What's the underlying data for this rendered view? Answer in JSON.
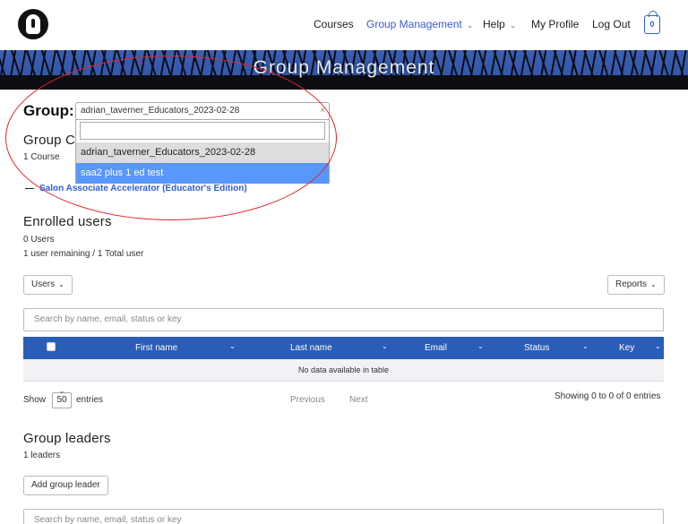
{
  "nav": {
    "items": [
      {
        "label": "Courses",
        "chevron": false
      },
      {
        "label": "Group Management",
        "chevron": true,
        "active": true
      },
      {
        "label": "Help",
        "chevron": true
      },
      {
        "label": "My Profile",
        "chevron": false
      },
      {
        "label": "Log Out",
        "chevron": false
      }
    ],
    "cart_count": "0",
    "accent": "#3a5bd0"
  },
  "banner": {
    "title": "Group Management"
  },
  "group": {
    "label": "Group:",
    "selected": "adrian_taverner_Educators_2023-02-28",
    "clear": "×",
    "options": [
      "adrian_taverner_Educators_2023-02-28",
      "saa2 plus 1 ed test"
    ]
  },
  "courses": {
    "title": "Group C",
    "count": "1 Course",
    "items": [
      "Salon Associate Accelerator (Educator's Edition)"
    ]
  },
  "enrolled": {
    "title": "Enrolled users",
    "count": "0 Users",
    "remaining": "1 user remaining / 1 Total user",
    "users_button": "Users",
    "reports_button": "Reports",
    "search_placeholder": "Search by name, email, status or key",
    "columns": [
      "First name",
      "Last name",
      "Email",
      "Status",
      "Key"
    ],
    "empty": "No data available in table",
    "show": "Show",
    "page_length": "50",
    "entries": "entries",
    "previous": "Previous",
    "next": "Next",
    "info": "Showing 0 to 0 of 0 entries",
    "header_color": "#2a5db8"
  },
  "leaders": {
    "title": "Group leaders",
    "count": "1 leaders",
    "add_button": "Add group leader",
    "search_placeholder": "Search by name, email, status or key"
  },
  "annotation_color": "#e0262b"
}
